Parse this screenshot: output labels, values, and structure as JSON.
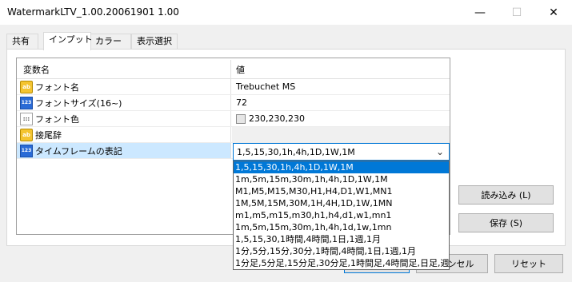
{
  "window": {
    "title": "WatermarkLTV_1.00.20061901 1.00",
    "minimize_glyph": "—",
    "maximize_glyph": "☐",
    "close_glyph": "✕"
  },
  "tabs": [
    {
      "label": "共有"
    },
    {
      "label": "インプット"
    },
    {
      "label": "カラー"
    },
    {
      "label": "表示選択"
    }
  ],
  "grid": {
    "header_name": "変数名",
    "header_value": "値",
    "rows": [
      {
        "icon": "ab",
        "name": "フォント名",
        "value": "Trebuchet MS"
      },
      {
        "icon": "123",
        "name": "フォントサイズ(16~)",
        "value": "72"
      },
      {
        "icon": "color",
        "name": "フォント色",
        "value": "230,230,230"
      },
      {
        "icon": "ab",
        "name": "接尾辞",
        "value": ""
      },
      {
        "icon": "123",
        "name": "タイムフレームの表記",
        "value": "1,5,15,30,1h,4h,1D,1W,1M"
      }
    ]
  },
  "icons": {
    "ab": "ab",
    "123": "123",
    "color": ":::"
  },
  "dropdown": {
    "options": [
      "1,5,15,30,1h,4h,1D,1W,1M",
      "1m,5m,15m,30m,1h,4h,1D,1W,1M",
      "M1,M5,M15,M30,H1,H4,D1,W1,MN1",
      "1M,5M,15M,30M,1H,4H,1D,1W,1MN",
      "m1,m5,m15,m30,h1,h4,d1,w1,mn1",
      "1m,5m,15m,30m,1h,4h,1d,1w,1mn",
      "1,5,15,30,1時間,4時間,1日,1週,1月",
      "1分,5分,15分,30分,1時間,4時間,1日,1週,1月",
      "1分足,5分足,15分足,30分足,1時間足,4時間足,日足,週足,月足"
    ]
  },
  "buttons": {
    "load": "読み込み (L)",
    "save": "保存 (S)",
    "ok_partial": "",
    "cancel": "キャンセル",
    "reset": "リセット"
  }
}
